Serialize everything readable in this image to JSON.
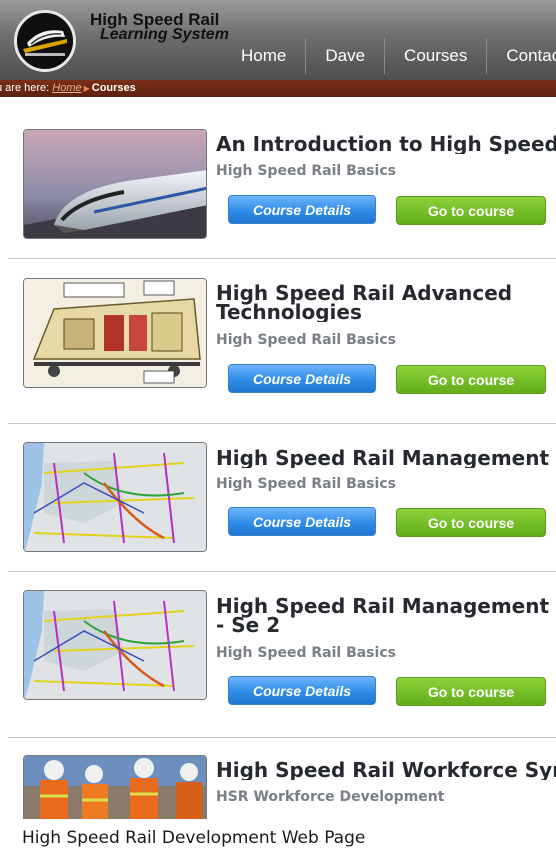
{
  "brand": {
    "line1": "High Speed Rail",
    "line2": "Learning System"
  },
  "nav": [
    "Home",
    "Dave",
    "Courses",
    "Contac"
  ],
  "breadcrumb": {
    "prefix": "u are here:",
    "home": "Home",
    "current": "Courses"
  },
  "buttons": {
    "details": "Course Details",
    "go": "Go to course"
  },
  "courses": [
    {
      "title": "An Introduction to High Speed Ra",
      "category": "High Speed Rail Basics",
      "thumb": "bullet-train-photo"
    },
    {
      "title": "High Speed Rail Advanced Technologies",
      "category": "High Speed Rail Basics",
      "thumb": "train-cutaway-diagram"
    },
    {
      "title": "High Speed Rail Management",
      "category": "High Speed Rail Basics",
      "thumb": "rail-network-map"
    },
    {
      "title": "High Speed Rail Management - Se 2",
      "category": "High Speed Rail Basics",
      "thumb": "rail-network-map"
    },
    {
      "title": "High Speed Rail Workforce Sympo",
      "category": "HSR Workforce Development",
      "thumb": "workers-photo"
    }
  ],
  "caption": "High Speed Rail Development Web Page"
}
